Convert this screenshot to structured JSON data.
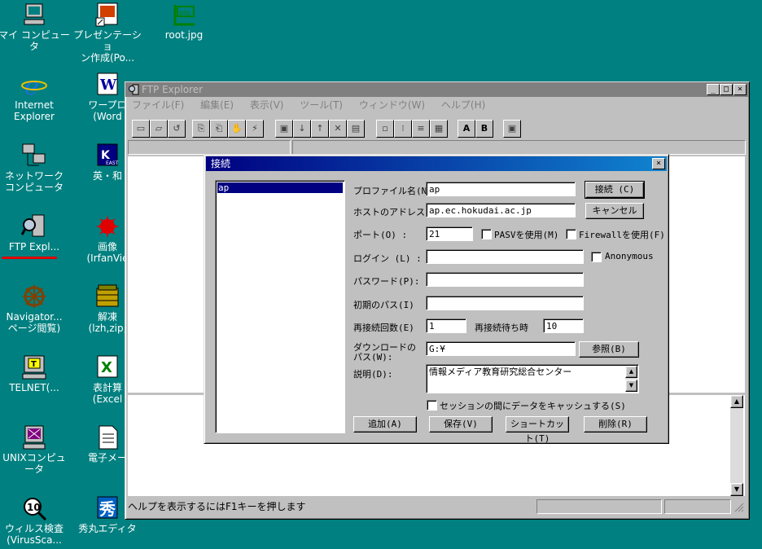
{
  "desktop_icons": [
    {
      "label": "マイ コンピュータ",
      "icon": "computer-icon"
    },
    {
      "label": "プレゼンテーショ\nン作成(Po...",
      "icon": "powerpoint-icon"
    },
    {
      "label": "root.jpg",
      "icon": "image-file-icon"
    },
    {
      "label": "Internet\nExplorer",
      "icon": "ie-icon"
    },
    {
      "label": "ワープロ\n(Word",
      "icon": "word-icon"
    },
    {
      "label": "ネットワーク\nコンピュータ",
      "icon": "network-icon"
    },
    {
      "label": "英・和",
      "icon": "dictionary-icon"
    },
    {
      "label": "FTP Expl...",
      "icon": "ftp-explorer-icon"
    },
    {
      "label": "画像\n(IrfanVie",
      "icon": "irfanview-icon"
    },
    {
      "label": "Navigator...\nページ閲覧)",
      "icon": "navigator-icon"
    },
    {
      "label": "解凍\n(lzh,zip,",
      "icon": "archive-icon"
    },
    {
      "label": "TELNET(...",
      "icon": "telnet-icon"
    },
    {
      "label": "表計算\n(Excel",
      "icon": "excel-icon"
    },
    {
      "label": "UNIXコンピュータ",
      "icon": "unix-icon"
    },
    {
      "label": "電子メー",
      "icon": "mail-icon"
    },
    {
      "label": "ウィルス検査\n(VirusSca...",
      "icon": "virus-scan-icon"
    },
    {
      "label": "秀丸エディタ",
      "icon": "hidemaru-icon"
    }
  ],
  "ftp_window": {
    "title": "FTP Explorer",
    "menu": [
      "ファイル(F)",
      "編集(E)",
      "表示(V)",
      "ツール(T)",
      "ウィンドウ(W)",
      "ヘルプ(H)"
    ],
    "status": "ヘルプを表示するにはF1キーを押します"
  },
  "dialog": {
    "title": "接続",
    "profiles": [
      "ap"
    ],
    "labels": {
      "profile_name": "プロファイル名(N):",
      "host": "ホストのアドレス(H):",
      "port": "ポート(O) :",
      "pasv": "PASVを使用(M)",
      "firewall": "Firewallを使用(F)",
      "login": "ログイン (L) :",
      "anonymous": "Anonymous",
      "password": "パスワード(P):",
      "initial_path": "初期のパス(I)",
      "retry_count": "再接続回数(E)",
      "retry_wait": "再接続待ち時",
      "download_path_1": "ダウンロードの",
      "download_path_2": "パス(W):",
      "description": "説明(D):",
      "cache": "セッションの間にデータをキャッシュする(S)"
    },
    "values": {
      "profile_name": "ap",
      "host": "ap.ec.hokudai.ac.jp",
      "port": "21",
      "login": "",
      "password": "",
      "initial_path": "",
      "retry_count": "1",
      "retry_wait": "10",
      "download_path": "G:¥",
      "description": "情報メディア教育研究総合センター"
    },
    "buttons": {
      "connect": "接続 (C)",
      "cancel": "キャンセル",
      "browse": "参照(B)",
      "add": "追加(A)",
      "save": "保存(V)",
      "shortcut": "ショートカット(T)",
      "delete": "削除(R)"
    }
  }
}
